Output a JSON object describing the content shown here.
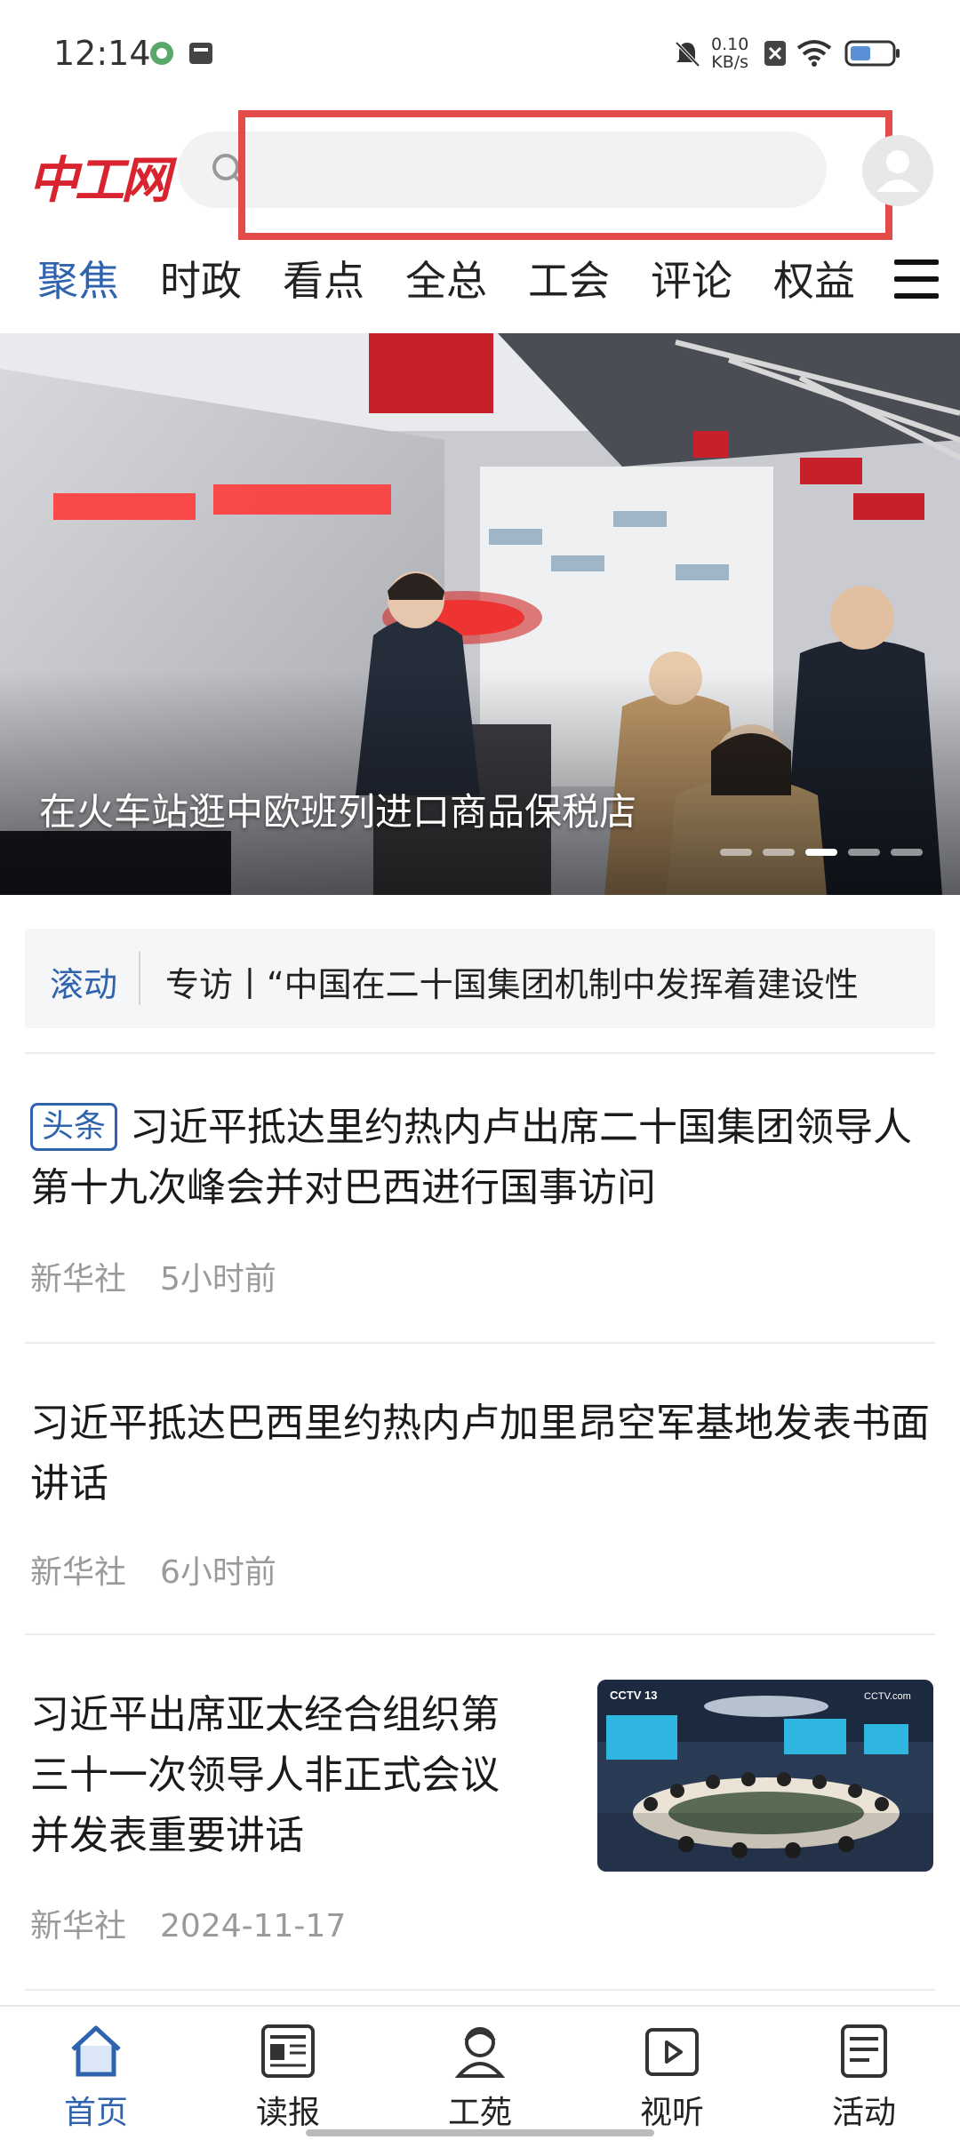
{
  "status_bar": {
    "time": "12:14",
    "net_speed_value": "0.10",
    "net_speed_unit": "KB/s"
  },
  "header": {
    "logo_text": "中工网",
    "search_placeholder": "",
    "highlight_color": "#e34b4b"
  },
  "tabs": [
    {
      "label": "聚焦",
      "active": true
    },
    {
      "label": "时政",
      "active": false
    },
    {
      "label": "看点",
      "active": false
    },
    {
      "label": "全总",
      "active": false
    },
    {
      "label": "工会",
      "active": false
    },
    {
      "label": "评论",
      "active": false
    },
    {
      "label": "权益",
      "active": false
    }
  ],
  "banner": {
    "caption": "在火车站逛中欧班列进口商品保税店",
    "slide_count": 5,
    "active_slide": 3
  },
  "ticker": {
    "label": "滚动",
    "text": "专访丨“中国在二十国集团机制中发挥着建设性"
  },
  "news": [
    {
      "tag": "头条",
      "title": "习近平抵达里约热内卢出席二十国集团领导人第十九次峰会并对巴西进行国事访问",
      "source": "新华社",
      "time": "5小时前"
    },
    {
      "title": "习近平抵达巴西里约热内卢加里昂空军基地发表书面讲话",
      "source": "新华社",
      "time": "6小时前"
    },
    {
      "title": "习近平出席亚太经合组织第三十一次领导人非正式会议并发表重要讲话",
      "title_lines": [
        "习近平出席亚太经合组织第",
        "三十一次领导人非正式会议",
        "并发表重要讲话"
      ],
      "source": "新华社",
      "time": "2024-11-17",
      "thumb_channel": "CCTV 13",
      "thumb_watermark": "CCTV.com"
    }
  ],
  "bottom_nav": [
    {
      "label": "首页",
      "icon": "home-icon",
      "active": true
    },
    {
      "label": "读报",
      "icon": "newspaper-icon",
      "active": false
    },
    {
      "label": "工苑",
      "icon": "worker-icon",
      "active": false
    },
    {
      "label": "视听",
      "icon": "video-icon",
      "active": false
    },
    {
      "label": "活动",
      "icon": "activity-icon",
      "active": false
    }
  ],
  "colors": {
    "accent": "#2f63ad",
    "brand": "#d9232e"
  }
}
